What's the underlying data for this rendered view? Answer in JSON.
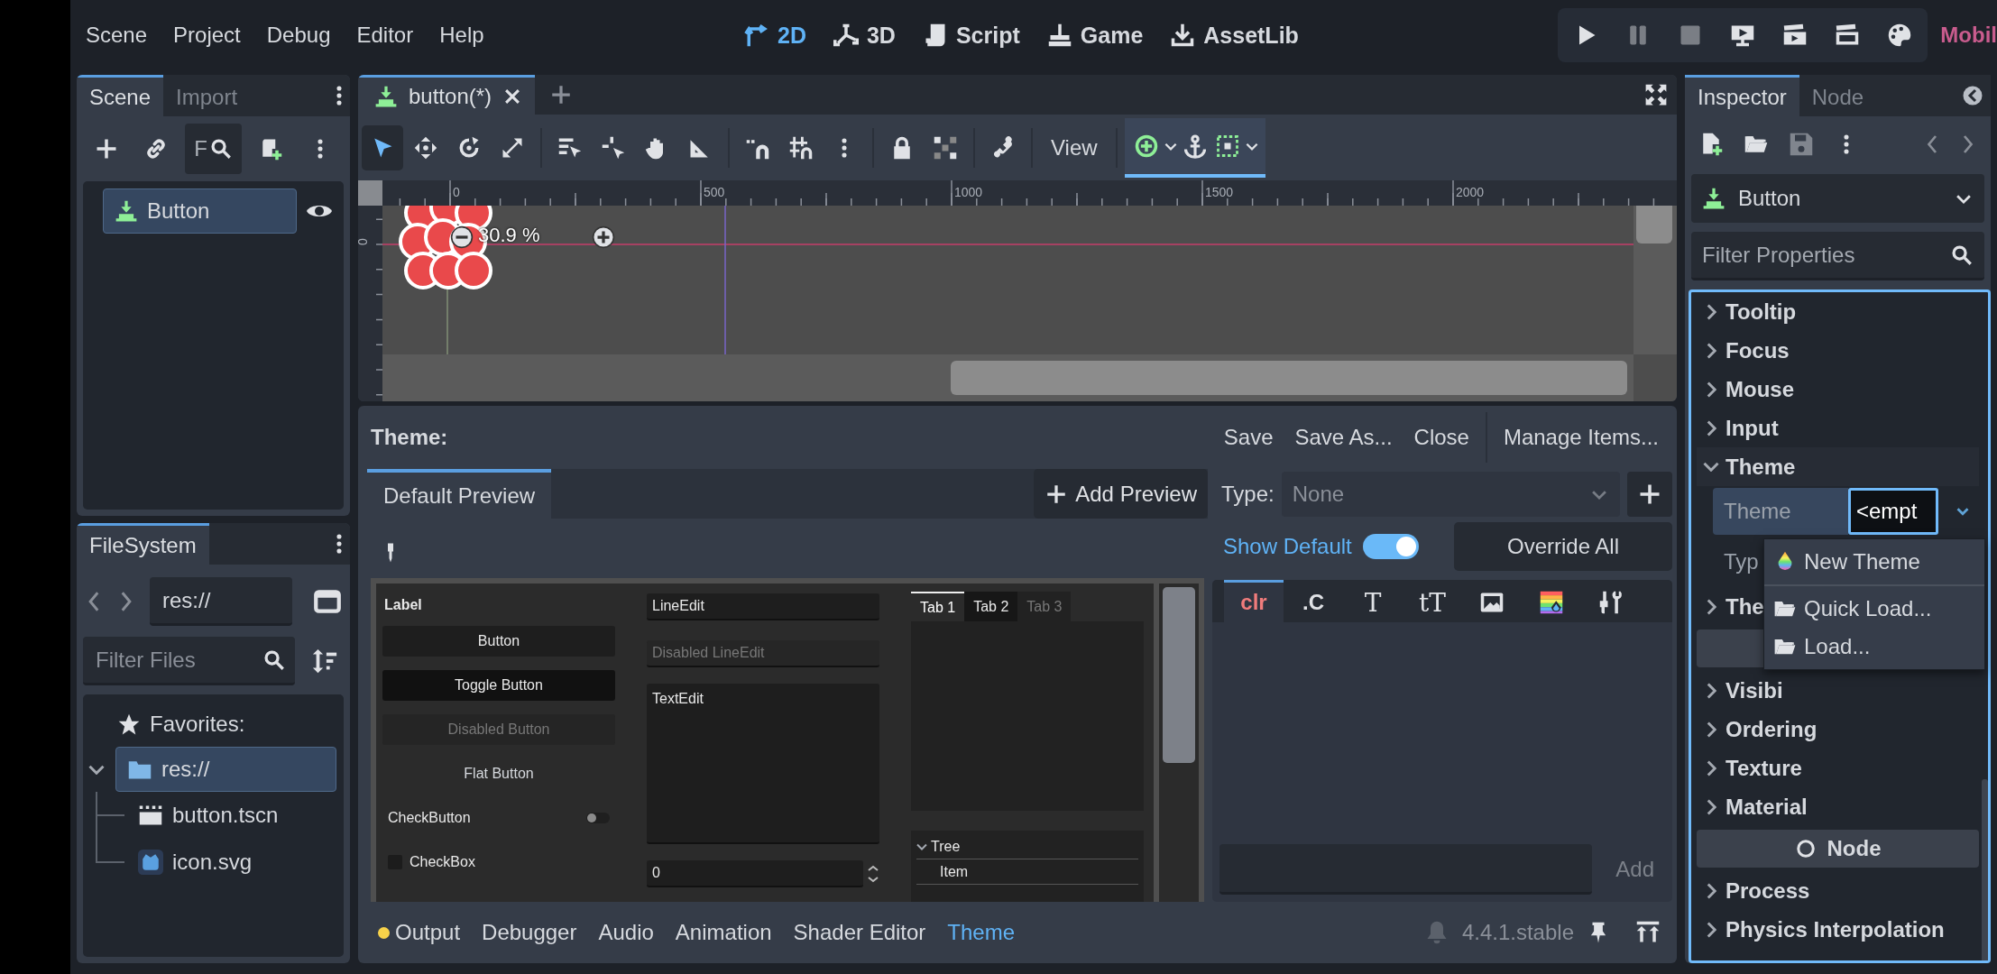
{
  "menu": [
    "Scene",
    "Project",
    "Debug",
    "Editor",
    "Help"
  ],
  "workspaces": [
    {
      "label": "2D",
      "selected": true
    },
    {
      "label": "3D",
      "selected": false
    },
    {
      "label": "Script",
      "selected": false
    },
    {
      "label": "Game",
      "selected": false
    },
    {
      "label": "AssetLib",
      "selected": false
    }
  ],
  "run_bar": {
    "buttons": [
      {
        "disabled": false
      },
      {
        "disabled": true
      },
      {
        "disabled": true
      },
      {
        "disabled": false
      },
      {
        "disabled": false
      },
      {
        "disabled": false
      },
      {
        "disabled": false
      }
    ],
    "renderer": "Mobil"
  },
  "scene_dock": {
    "tabs": [
      {
        "label": "Scene",
        "selected": true
      },
      {
        "label": "Import",
        "selected": false
      }
    ],
    "filter_button": "F",
    "tree": [
      {
        "label": "Button",
        "selected": true,
        "visible": true
      }
    ]
  },
  "filesystem_dock": {
    "tabs": [
      {
        "label": "FileSystem",
        "selected": true
      }
    ],
    "path": "res://",
    "filter": {
      "placeholder": "Filter Files"
    },
    "favorites": "Favorites:",
    "tree": [
      {
        "label": "res://",
        "selected": true,
        "expanded": true,
        "children": [
          {
            "label": "button.tscn",
            "kind": "scene",
            "selected": false
          },
          {
            "label": "icon.svg",
            "kind": "image",
            "selected": false
          }
        ]
      }
    ]
  },
  "scene_tabs": [
    {
      "label": "button(*)",
      "selected": true
    }
  ],
  "toolbar": {
    "tools": [
      {
        "selected": true
      },
      {
        "selected": false
      },
      {
        "selected": false
      },
      {
        "selected": false
      },
      {
        "selected": false
      },
      {
        "selected": false
      },
      {
        "selected": false
      },
      {
        "selected": false
      },
      {
        "selected": false
      },
      {
        "selected": false
      },
      {
        "selected": false
      },
      {
        "selected": false
      },
      {
        "selected": false
      },
      {
        "selected": false
      }
    ],
    "view_menu": "View"
  },
  "viewport": {
    "ruler_labels": [
      "0",
      "500",
      "1000",
      "1500",
      "2000"
    ],
    "vertical_ruler_label": "0",
    "zoom": "30.9 %"
  },
  "theme_editor": {
    "title": "Theme:",
    "actions": [
      "Save",
      "Save As...",
      "Close",
      "Manage Items..."
    ],
    "preview_tabs": [
      {
        "label": "Default Preview",
        "selected": true
      }
    ],
    "add_preview": "Add Preview",
    "preview": {
      "label": "Label",
      "buttons": [
        {
          "label": "Button",
          "kind": "normal"
        },
        {
          "label": "Toggle Button",
          "kind": "pressed"
        },
        {
          "label": "Disabled Button",
          "kind": "disabled"
        },
        {
          "label": "Flat Button",
          "kind": "flat"
        }
      ],
      "check_button": {
        "label": "CheckButton",
        "on": false
      },
      "check_box": {
        "label": "CheckBox",
        "checked": false
      },
      "line_edits": [
        {
          "value": "LineEdit",
          "disabled": false
        },
        {
          "value": "Disabled LineEdit",
          "disabled": true
        }
      ],
      "text_edit": "TextEdit",
      "spin_box": "0",
      "tabs": [
        {
          "label": "Tab 1",
          "selected": true,
          "disabled": false
        },
        {
          "label": "Tab 2",
          "selected": false,
          "disabled": false
        },
        {
          "label": "Tab 3",
          "selected": false,
          "disabled": true
        }
      ],
      "tree": {
        "label": "Tree",
        "expanded": true,
        "children": [
          {
            "label": "Item"
          }
        ]
      }
    },
    "type_label": "Type:",
    "type_select": {
      "placeholder": "None"
    },
    "show_default": {
      "label": "Show Default",
      "on": true
    },
    "override_all": "Override All",
    "item_tabs": [
      {
        "kind": "text",
        "text": "clr",
        "selected": true
      },
      {
        "kind": "text",
        "text": ".C",
        "selected": false
      },
      {
        "kind": "serif",
        "text": "T",
        "selected": false
      },
      {
        "kind": "serif",
        "text": "tT",
        "selected": false
      },
      {
        "kind": "image",
        "selected": false
      },
      {
        "kind": "palette",
        "selected": false
      },
      {
        "kind": "tools",
        "selected": false
      }
    ],
    "add_button": {
      "label": "Add",
      "disabled": true
    }
  },
  "bottom_tabs": [
    {
      "label": "Output",
      "selected": false,
      "notice": true
    },
    {
      "label": "Debugger",
      "selected": false,
      "notice": false
    },
    {
      "label": "Audio",
      "selected": false,
      "notice": false
    },
    {
      "label": "Animation",
      "selected": false,
      "notice": false
    },
    {
      "label": "Shader Editor",
      "selected": false,
      "notice": false
    },
    {
      "label": "Theme",
      "selected": true,
      "notice": false
    }
  ],
  "version": "4.4.1.stable",
  "inspector": {
    "tabs": [
      {
        "label": "Inspector",
        "selected": true
      },
      {
        "label": "Node",
        "selected": false
      }
    ],
    "object": "Button",
    "filter": {
      "placeholder": "Filter Properties"
    },
    "properties": [
      {
        "kind": "section",
        "label": "Tooltip",
        "expanded": false
      },
      {
        "kind": "section",
        "label": "Focus",
        "expanded": false
      },
      {
        "kind": "section",
        "label": "Mouse",
        "expanded": false
      },
      {
        "kind": "section",
        "label": "Input",
        "expanded": false
      },
      {
        "kind": "section",
        "label": "Theme",
        "expanded": true,
        "children": [
          {
            "kind": "resource",
            "label": "Theme",
            "value": "<empt",
            "selected": true,
            "focused": true
          },
          {
            "kind": "property",
            "label": "Typ",
            "selected": false
          }
        ]
      },
      {
        "kind": "section",
        "label": "The",
        "expanded": false
      },
      {
        "kind": "category"
      },
      {
        "kind": "section",
        "label": "Visibi",
        "expanded": false
      },
      {
        "kind": "section",
        "label": "Ordering",
        "expanded": false
      },
      {
        "kind": "section",
        "label": "Texture",
        "expanded": false
      },
      {
        "kind": "section",
        "label": "Material",
        "expanded": false
      },
      {
        "kind": "category",
        "label": "Node"
      },
      {
        "kind": "section",
        "label": "Process",
        "expanded": false
      },
      {
        "kind": "section",
        "label": "Physics Interpolation",
        "expanded": false
      }
    ],
    "popup": {
      "items": [
        {
          "kind": "new",
          "label": "New Theme"
        },
        {
          "kind": "separator"
        },
        {
          "kind": "load",
          "label": "Quick Load..."
        },
        {
          "kind": "load",
          "label": "Load..."
        }
      ]
    }
  }
}
